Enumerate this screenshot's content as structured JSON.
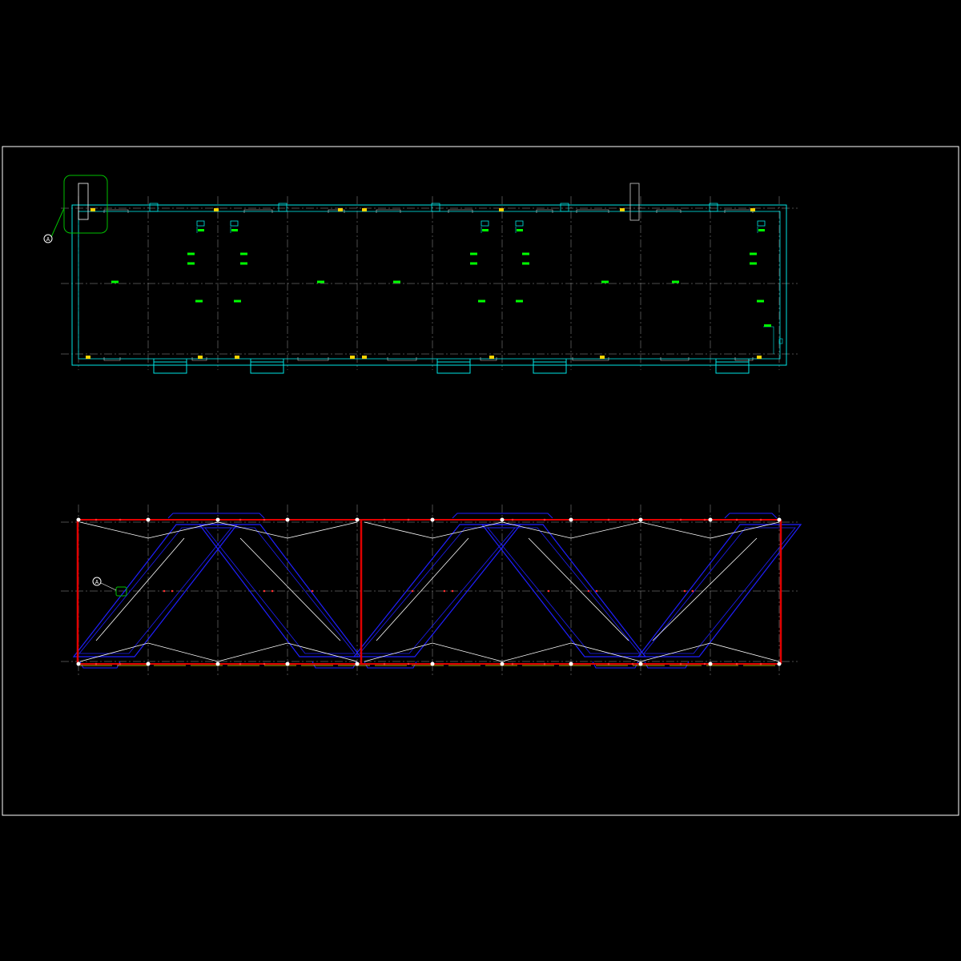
{
  "drawing": {
    "background": "#000000",
    "colors": {
      "frame": "#ffffff",
      "grid": "#9a9a9a",
      "wall": "#00e5e5",
      "label": "#00ff00",
      "detail": "#00c000",
      "beam": "#e00000",
      "hatch": "#1f1fff",
      "truss": "#ffffff",
      "marker": "#ffd400"
    },
    "plan_top": {
      "labels": [],
      "detail_callout": {
        "symbol": "A"
      }
    },
    "plan_bottom": {
      "detail_callout": {
        "symbol": "A"
      }
    }
  }
}
